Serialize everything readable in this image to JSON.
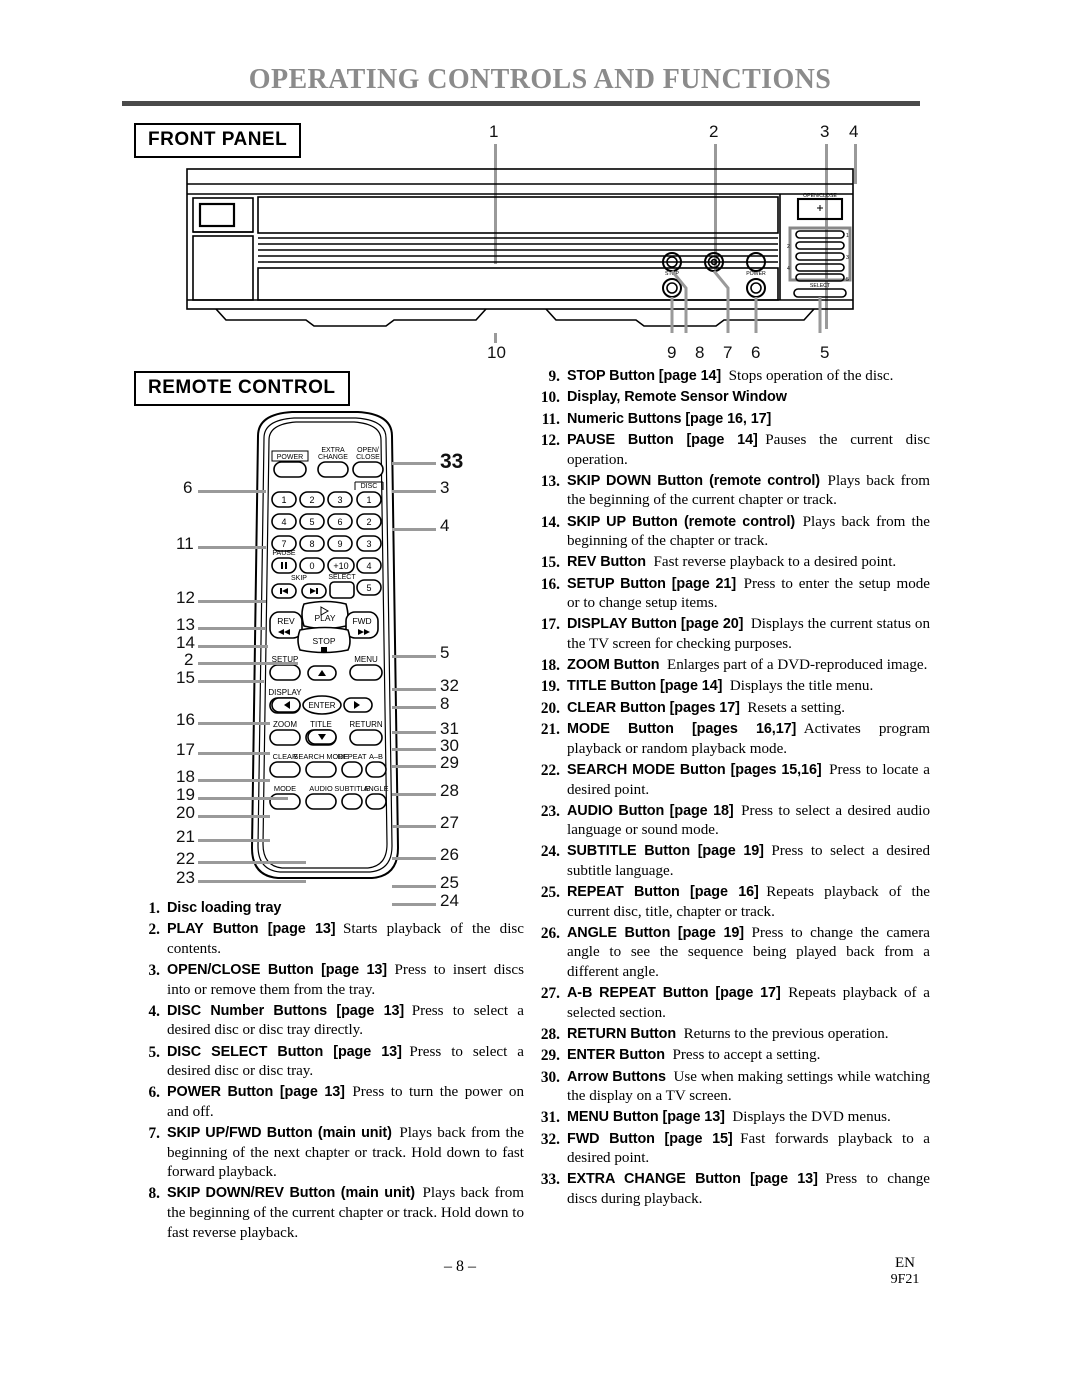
{
  "document": {
    "title": "OPERATING CONTROLS AND FUNCTIONS",
    "page_number": "– 8 –",
    "footer_language": "EN",
    "footer_code": "9F21"
  },
  "sections": {
    "front_panel": "FRONT PANEL",
    "remote_control": "REMOTE CONTROL"
  },
  "front_panel_diagram": {
    "callouts_top": [
      "1",
      "2",
      "3",
      "4"
    ],
    "callouts_bottom": [
      "10",
      "9",
      "8",
      "7",
      "6",
      "5"
    ],
    "labels": {
      "open_close": "OPEN/CLOSE",
      "stop": "STOP",
      "power": "POWER",
      "select": "SELECT",
      "disc_numbers": [
        "1",
        "2",
        "3",
        "4",
        "5"
      ]
    }
  },
  "remote_diagram": {
    "callouts_left": [
      "6",
      "11",
      "12",
      "13",
      "14",
      "2",
      "15",
      "16",
      "17",
      "18",
      "19",
      "20",
      "21",
      "22",
      "23"
    ],
    "callouts_right": [
      "33",
      "3",
      "4",
      "5",
      "32",
      "8",
      "31",
      "30",
      "29",
      "28",
      "27",
      "26",
      "25",
      "24"
    ],
    "buttons": {
      "power": "POWER",
      "extra_change": "EXTRA CHANGE",
      "open_close": "OPEN/ CLOSE",
      "disc_group": "DISC",
      "numeric": [
        "1",
        "2",
        "3",
        "4",
        "5",
        "6",
        "7",
        "8",
        "9",
        "0",
        "+10"
      ],
      "disc_numbers": [
        "1",
        "2",
        "3",
        "4",
        "5"
      ],
      "pause": "PAUSE",
      "skip": "SKIP",
      "select": "SELECT",
      "play": "PLAY",
      "rev": "REV",
      "fwd": "FWD",
      "stop": "STOP",
      "setup": "SETUP",
      "menu": "MENU",
      "display": "DISPLAY",
      "enter": "ENTER",
      "zoom": "ZOOM",
      "title": "TITLE",
      "return": "RETURN",
      "clear": "CLEAR",
      "search_mode": "SEARCH MODE",
      "repeat": "REPEAT",
      "ab": "A–B",
      "mode": "MODE",
      "audio": "AUDIO",
      "subtitle": "SUBTITLE",
      "angle": "ANGLE"
    }
  },
  "list_left": [
    {
      "n": "1.",
      "bold": "Disc loading tray",
      "text": ""
    },
    {
      "n": "2.",
      "bold": "PLAY Button [page 13]",
      "text": "Starts playback of the disc contents."
    },
    {
      "n": "3.",
      "bold": "OPEN/CLOSE Button [page 13]",
      "text": "Press to insert discs into or remove them from the tray."
    },
    {
      "n": "4.",
      "bold": "DISC Number Buttons [page 13]",
      "text": "Press to select a desired disc or disc tray directly."
    },
    {
      "n": "5.",
      "bold": "DISC SELECT Button [page 13]",
      "text": "Press to select a desired disc or disc tray."
    },
    {
      "n": "6.",
      "bold": "POWER Button [page 13]",
      "text": "Press to turn the power on and off."
    },
    {
      "n": "7.",
      "bold": "SKIP UP/FWD Button (main unit)",
      "text": "Plays back from the beginning of the next chapter or track. Hold down to fast forward playback."
    },
    {
      "n": "8.",
      "bold": "SKIP DOWN/REV Button (main unit)",
      "text": "Plays back from the beginning of the current chapter or track. Hold down to fast reverse playback."
    }
  ],
  "list_right": [
    {
      "n": "9.",
      "bold": "STOP Button [page 14]",
      "text": "Stops operation of the disc."
    },
    {
      "n": "10.",
      "bold": "Display, Remote Sensor Window",
      "text": ""
    },
    {
      "n": "11.",
      "bold": "Numeric Buttons [page 16, 17]",
      "text": ""
    },
    {
      "n": "12.",
      "bold": "PAUSE Button [page 14]",
      "text": "Pauses the current disc operation."
    },
    {
      "n": "13.",
      "bold": "SKIP DOWN Button (remote control)",
      "text": "Plays back from the beginning of the current chapter or track."
    },
    {
      "n": "14.",
      "bold": "SKIP UP Button (remote control)",
      "text": "Plays back from the beginning of the chapter or track."
    },
    {
      "n": "15.",
      "bold": "REV Button",
      "text": "Fast reverse playback to a desired point."
    },
    {
      "n": "16.",
      "bold": "SETUP Button [page 21]",
      "text": "Press to enter the setup mode or to change setup items."
    },
    {
      "n": "17.",
      "bold": "DISPLAY Button [page 20]",
      "text": "Displays the current status on the TV screen for checking purposes."
    },
    {
      "n": "18.",
      "bold": "ZOOM Button",
      "text": "Enlarges part of a DVD-reproduced image."
    },
    {
      "n": "19.",
      "bold": "TITLE Button [page 14]",
      "text": "Displays the title menu."
    },
    {
      "n": "20.",
      "bold": "CLEAR Button [pages 17]",
      "text": "Resets a setting."
    },
    {
      "n": "21.",
      "bold": "MODE Button [pages 16,17]",
      "text": "Activates program playback or random playback mode."
    },
    {
      "n": "22.",
      "bold": "SEARCH MODE Button [pages 15,16]",
      "text": "Press to locate a desired point."
    },
    {
      "n": "23.",
      "bold": "AUDIO Button [page 18]",
      "text": "Press to select a desired audio language or sound mode."
    },
    {
      "n": "24.",
      "bold": "SUBTITLE Button [page 19]",
      "text": "Press to select a desired subtitle language."
    },
    {
      "n": "25.",
      "bold": "REPEAT Button [page 16]",
      "text": "Repeats playback of the current disc, title, chapter or track."
    },
    {
      "n": "26.",
      "bold": "ANGLE Button [page 19]",
      "text": "Press to change the camera angle to see the sequence being played back from a different angle."
    },
    {
      "n": "27.",
      "bold": "A-B REPEAT Button [page 17]",
      "text": "Repeats playback of a selected section."
    },
    {
      "n": "28.",
      "bold": "RETURN Button",
      "text": "Returns to the previous operation."
    },
    {
      "n": "29.",
      "bold": "ENTER Button",
      "text": "Press to accept a setting."
    },
    {
      "n": "30.",
      "bold": "Arrow Buttons",
      "text": "Use when making settings while watching the display on a TV screen."
    },
    {
      "n": "31.",
      "bold": "MENU Button [page 13]",
      "text": "Displays the DVD menus."
    },
    {
      "n": "32.",
      "bold": "FWD Button [page 15]",
      "text": "Fast forwards playback to a desired point."
    },
    {
      "n": "33.",
      "bold": "EXTRA CHANGE Button [page 13]",
      "text": "Press to change discs during playback."
    }
  ]
}
